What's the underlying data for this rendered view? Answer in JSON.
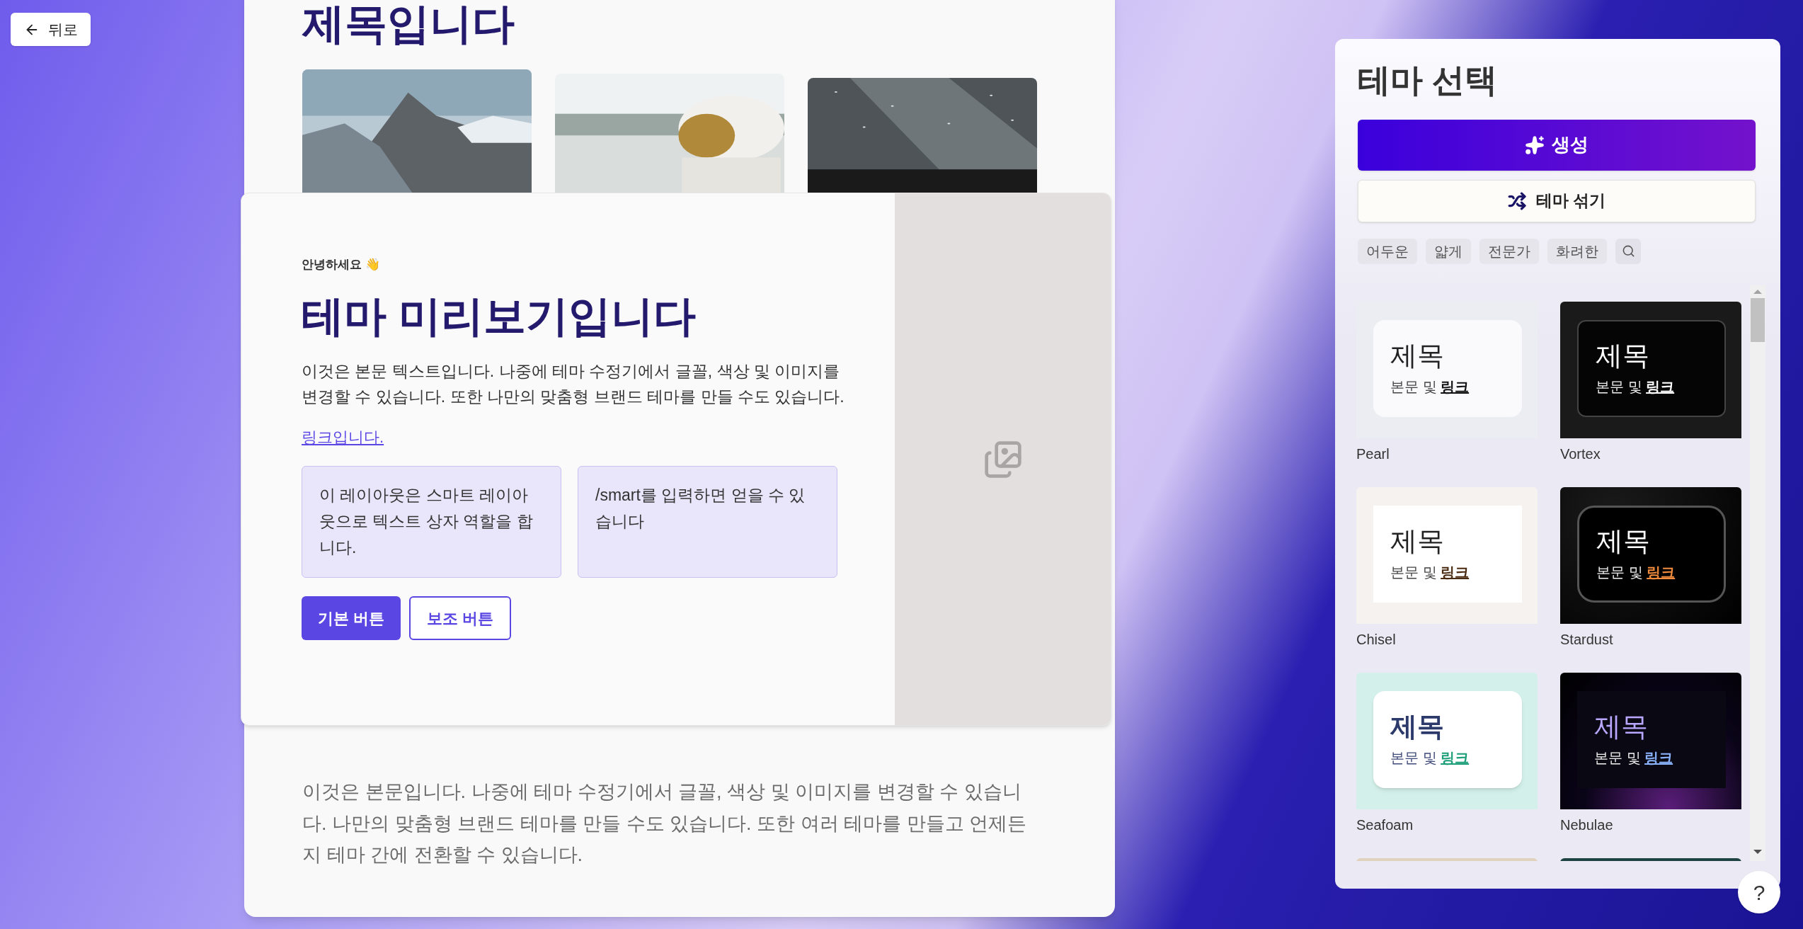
{
  "back_button": {
    "label": "뒤로"
  },
  "slide": {
    "title": "제목입니다",
    "body": "이것은 본문입니다. 나중에 테마 수정기에서 글꼴, 색상 및 이미지를 변경할 수 있습니다. 나만의 맞춤형 브랜드 테마를 만들 수도 있습니다. 또한 여러 테마를 만들고 언제든지 테마 간에 전환할 수 있습니다."
  },
  "preview": {
    "greeting": "안녕하세요 👋",
    "title": "테마 미리보기입니다",
    "body": "이것은 본문 텍스트입니다. 나중에 테마 수정기에서 글꼴, 색상 및 이미지를 변경할 수 있습니다. 또한 나만의 맞춤형 브랜드 테마를 만들 수도 있습니다.",
    "link": "링크입니다.",
    "boxes": [
      "이 레이아웃은 스마트 레이아웃으로 텍스트 상자 역할을 합니다.",
      "/smart를 입력하면 얻을 수 있습니다"
    ],
    "buttons": [
      {
        "label": "기본 버튼",
        "kind": "primary"
      },
      {
        "label": "보조 버튼",
        "kind": "secondary"
      }
    ]
  },
  "theme_panel": {
    "title": "테마 선택",
    "generate_button": "생성",
    "shuffle_button": "테마 섞기",
    "filters": [
      "어두운",
      "얇게",
      "전문가",
      "화려한"
    ],
    "themes": [
      {
        "name": "Pearl",
        "kind": "pearl",
        "heading": "제목",
        "body": "본문 및",
        "link": "링크"
      },
      {
        "name": "Vortex",
        "kind": "vortex",
        "heading": "제목",
        "body": "본문 및",
        "link": "링크"
      },
      {
        "name": "Chisel",
        "kind": "chisel",
        "heading": "제목",
        "body": "본문 및",
        "link": "링크"
      },
      {
        "name": "Stardust",
        "kind": "stardust",
        "heading": "제목",
        "body": "본문 및",
        "link": "링크"
      },
      {
        "name": "Seafoam",
        "kind": "seafoam",
        "heading": "제목",
        "body": "본문 및",
        "link": "링크"
      },
      {
        "name": "Nebulae",
        "kind": "nebulae",
        "heading": "제목",
        "body": "본문 및",
        "link": "링크"
      }
    ],
    "more_themes": [
      {
        "color": "#e0d2bc"
      },
      {
        "color": "#1c4242"
      }
    ]
  },
  "help_button": {
    "label": "?"
  }
}
